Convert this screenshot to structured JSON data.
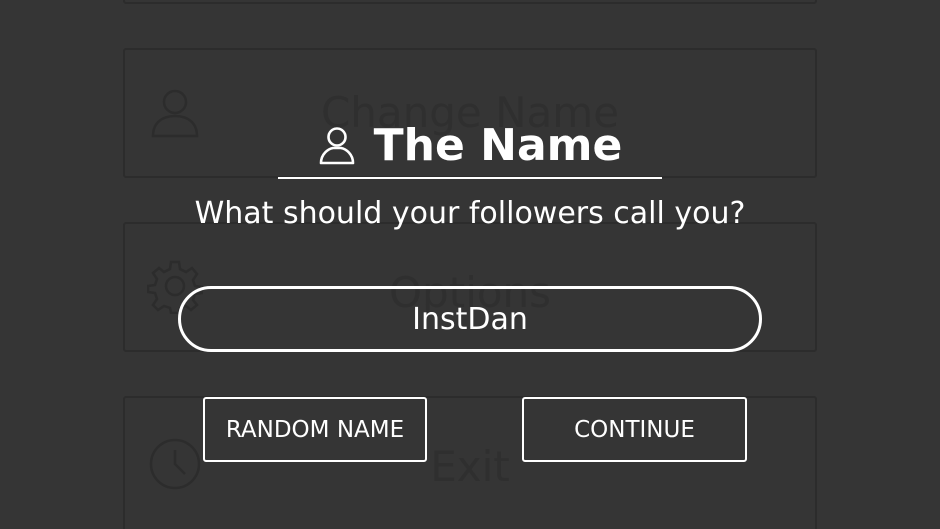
{
  "background_menu": {
    "items": [
      {
        "label": "",
        "icon": "blank"
      },
      {
        "label": "Change Name",
        "icon": "user-icon"
      },
      {
        "label": "Options",
        "icon": "gear-icon"
      },
      {
        "label": "Exit",
        "icon": "clock-icon"
      }
    ]
  },
  "dialog": {
    "title": "The Name",
    "title_icon": "user-icon",
    "prompt": "What should your followers call you?",
    "name_input": {
      "value": "InstDan"
    },
    "buttons": {
      "random_label": "RANDOM NAME",
      "continue_label": "CONTINUE"
    }
  },
  "colors": {
    "background": "#353535",
    "foreground": "#ffffff",
    "dimmed_outline": "#2c2c2c"
  }
}
